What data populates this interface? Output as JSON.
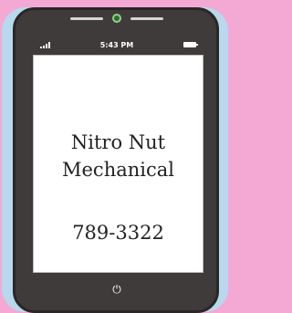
{
  "status_bar": {
    "time": "5:43 PM",
    "signal_icon": "signal-bars-icon",
    "battery_icon": "battery-icon"
  },
  "screen": {
    "business_name_line1": "Nitro Nut",
    "business_name_line2": "Mechanical",
    "phone_number": "789-3322"
  },
  "device": {
    "home_button_icon": "power-icon",
    "camera_icon": "camera-icon"
  },
  "colors": {
    "background_pink": "#f3a9d4",
    "backing_blue": "#b8d8ee",
    "phone_body": "#3f3b3a",
    "screen": "#ffffff",
    "camera_green": "#8fd08a"
  }
}
